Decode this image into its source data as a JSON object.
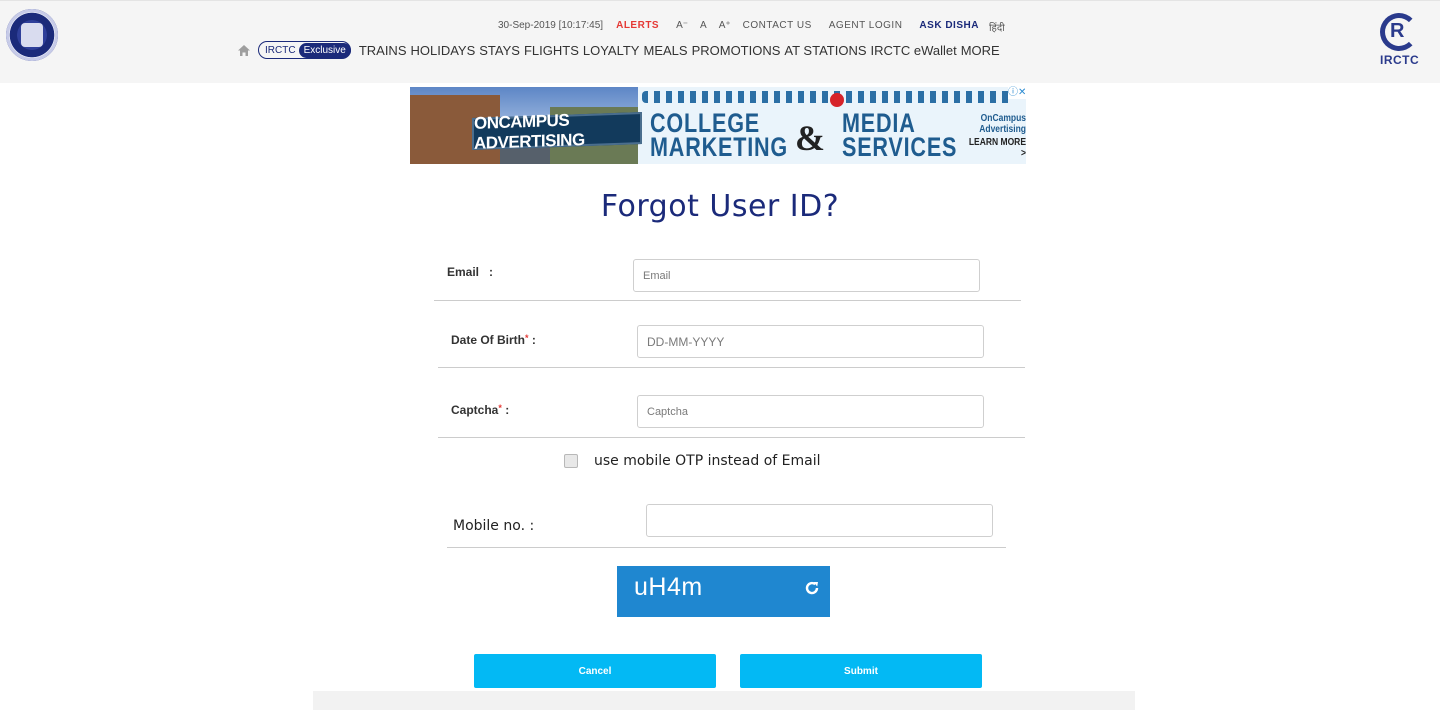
{
  "header": {
    "datetime": "30-Sep-2019 [10:17:45]",
    "alerts": "ALERTS",
    "font_small": "A⁻",
    "font_normal": "A",
    "font_large": "A⁺",
    "contact": "CONTACT US",
    "agent_login": "AGENT LOGIN",
    "ask_disha": "ASK DISHA",
    "hindi": "हिंदी",
    "exclusive_pill": {
      "brand": "IRCTC",
      "label": "Exclusive"
    },
    "nav": [
      "TRAINS",
      "HOLIDAYS",
      "STAYS",
      "FLIGHTS",
      "LOYALTY",
      "MEALS",
      "PROMOTIONS",
      "AT STATIONS",
      "IRCTC eWallet",
      "MORE"
    ],
    "logo_right_text": "IRCTC",
    "icons": {
      "home": "home-icon",
      "logo_left": "indian-railways-logo",
      "logo_right": "irctc-logo"
    }
  },
  "banner": {
    "sign": "ONCAMPUS ADVERTISING",
    "line1a": "COLLEGE",
    "line1b": "MARKETING",
    "amp": "&",
    "line2a": "MEDIA",
    "line2b": "SERVICES",
    "small1": "OnCampus",
    "small2": "Advertising",
    "learn": "LEARN MORE >"
  },
  "form": {
    "title": "Forgot User ID?",
    "email_label": "Email",
    "email_placeholder": "Email",
    "dob_label": "Date Of Birth",
    "dob_placeholder": "DD-MM-YYYY",
    "captcha_label": "Captcha",
    "captcha_placeholder": "Captcha",
    "required_mark": "*",
    "colon": ":",
    "otp_label": "use mobile OTP instead of Email",
    "mobile_label": "Mobile no. :",
    "mobile_value": "",
    "captcha_image_text": "uH4m",
    "cancel": "Cancel",
    "submit": "Submit"
  },
  "colors": {
    "brand": "#1b2a7a",
    "alert": "#e53935",
    "button": "#03b9f4",
    "captcha_bg": "#1f87d0"
  }
}
